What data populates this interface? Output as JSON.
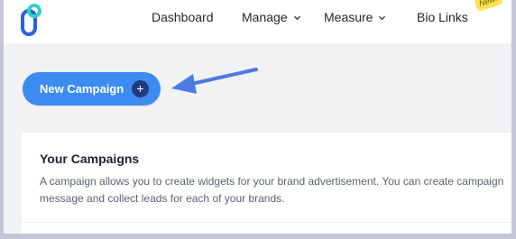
{
  "nav": {
    "items": [
      {
        "label": "Dashboard"
      },
      {
        "label": "Manage"
      },
      {
        "label": "Measure"
      },
      {
        "label": "Bio Links"
      }
    ],
    "badge": "New!"
  },
  "actions": {
    "new_campaign_label": "New Campaign",
    "plus_symbol": "+"
  },
  "campaigns": {
    "title": "Your Campaigns",
    "description": "A campaign allows you to create widgets for your brand advertisement. You can create campaign message and collect leads for each of your brands."
  },
  "colors": {
    "primary_button": "#3b8bf0",
    "plus_bg": "#233b7a",
    "annotation_arrow": "#4a7be3",
    "logo_teal": "#2fd1c4",
    "logo_blue": "#2b62d9",
    "badge": "#ffe14a"
  },
  "icons": {
    "logo": "brand-logo-icon",
    "chevron": "chevron-down-icon",
    "plus": "plus-icon",
    "arrow": "annotation-arrow"
  }
}
